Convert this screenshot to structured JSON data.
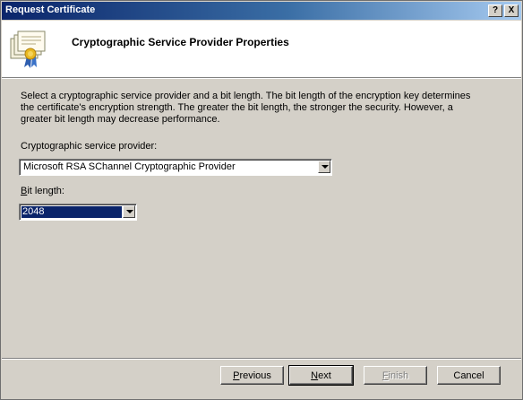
{
  "window": {
    "title": "Request Certificate",
    "help_label": "?",
    "close_label": "X"
  },
  "header": {
    "heading": "Cryptographic Service Provider Properties"
  },
  "intro": {
    "text": "Select a cryptographic service provider and a bit length. The bit length of the encryption key determines the certificate's encryption strength. The greater the bit length, the stronger the security. However, a greater bit length may decrease performance."
  },
  "csp": {
    "label": "Cryptographic service provider:",
    "value": "Microsoft RSA SChannel Cryptographic Provider"
  },
  "bit_length": {
    "label_accel": "B",
    "label_rest": "it length:",
    "value": "2048"
  },
  "buttons": {
    "previous_accel": "P",
    "previous_rest": "revious",
    "next_accel": "N",
    "next_rest": "ext",
    "finish_accel": "F",
    "finish_rest": "inish",
    "cancel": "Cancel"
  },
  "colors": {
    "titlebar_start": "#0a246a",
    "titlebar_end": "#a6caf0",
    "dialog_bg": "#d4d0c8",
    "selection": "#0a246a"
  },
  "icons": {
    "header": "certificate-icon"
  }
}
